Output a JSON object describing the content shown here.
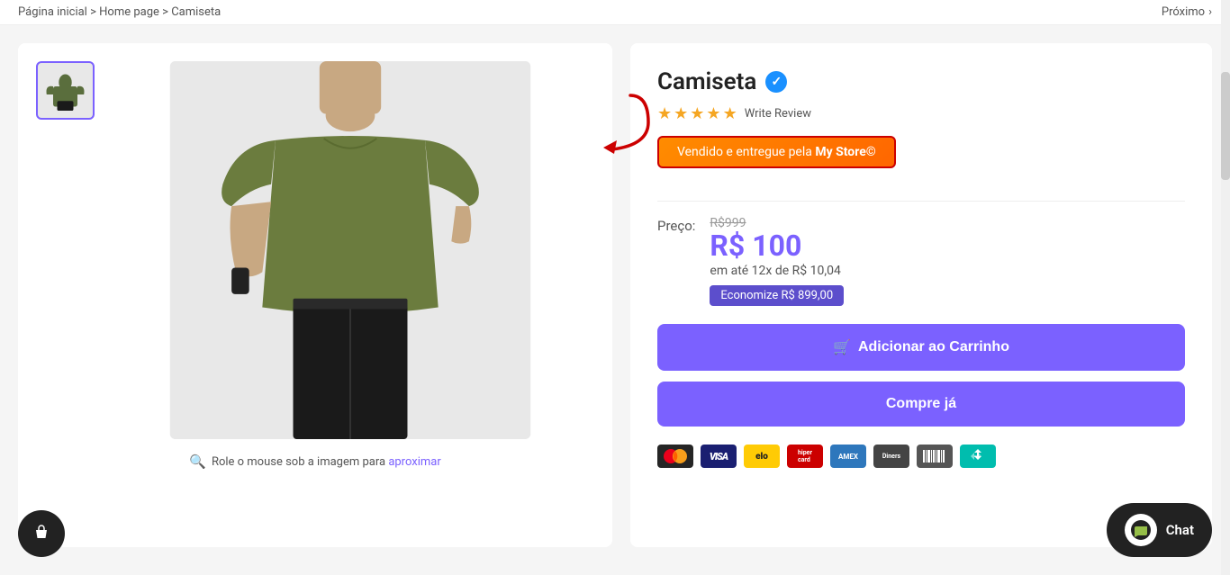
{
  "breadcrumb": {
    "home": "Página inicial",
    "sep1": ">",
    "homepage": "Home page",
    "sep2": ">",
    "current": "Camiseta",
    "next_label": "Próximo",
    "next_arrow": "›"
  },
  "product": {
    "title": "Camiseta",
    "verified": "✓",
    "stars": [
      "★",
      "★",
      "★",
      "★",
      "★"
    ],
    "write_review": "Write Review",
    "sold_by_prefix": "Vendido e entregue pela ",
    "sold_by_store": "My Store©",
    "price_label": "Preço:",
    "original_price": "R$999",
    "current_price": "R$ 100",
    "installment": "em até 12x de R$ 10,04",
    "savings": "Economize R$ 899,00",
    "btn_add_cart": "Adicionar ao Carrinho",
    "btn_buy_now": "Compre já",
    "cart_icon": "🛒",
    "zoom_hint": "Role o mouse sob a imagem para aproximar"
  },
  "payment_methods": [
    {
      "name": "mastercard",
      "label": "MC",
      "class": "pm-mastercard"
    },
    {
      "name": "visa",
      "label": "VISA",
      "class": "pm-visa"
    },
    {
      "name": "elo",
      "label": "elo",
      "class": "pm-elo"
    },
    {
      "name": "hipercard",
      "label": "Hiper",
      "class": "pm-hipercard"
    },
    {
      "name": "amex",
      "label": "AMEX",
      "class": "pm-amex"
    },
    {
      "name": "diners",
      "label": "Diners",
      "class": "pm-diners"
    },
    {
      "name": "boleto",
      "label": "Boleto",
      "class": "pm-boleto"
    },
    {
      "name": "pix",
      "label": "Pix",
      "class": "pm-pix"
    }
  ],
  "chat": {
    "label": "Chat"
  }
}
